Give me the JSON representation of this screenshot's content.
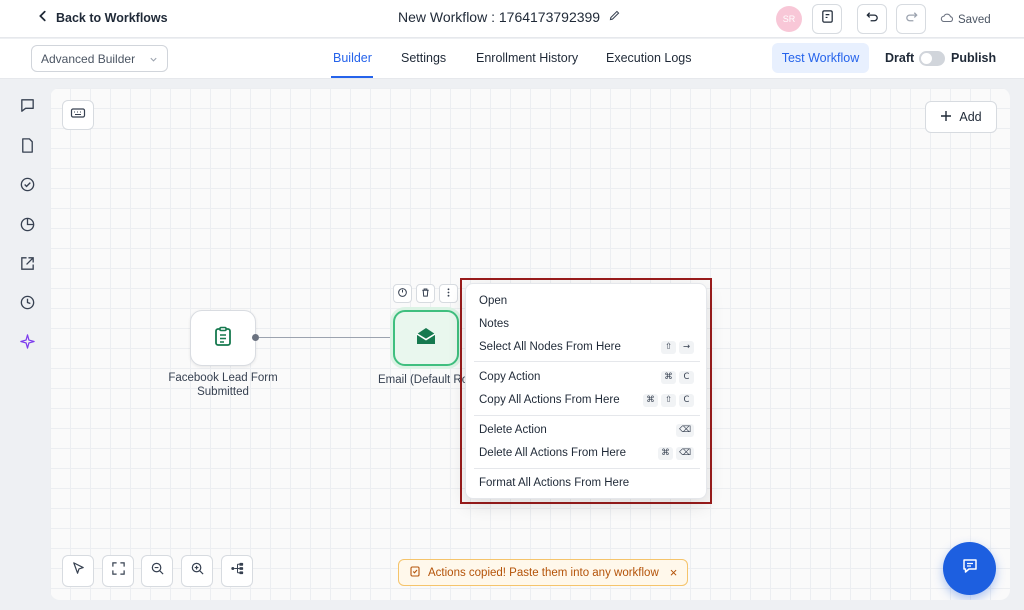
{
  "header": {
    "back_label": "Back to Workflows",
    "workflow_title": "New Workflow : 1764173792399",
    "avatar_initials": "SR",
    "saved_label": "Saved"
  },
  "nav": {
    "mode_select_value": "Advanced Builder",
    "tabs": [
      {
        "label": "Builder",
        "active": true
      },
      {
        "label": "Settings",
        "active": false
      },
      {
        "label": "Enrollment History",
        "active": false
      },
      {
        "label": "Execution Logs",
        "active": false
      }
    ],
    "test_workflow_label": "Test Workflow",
    "draft_label": "Draft",
    "publish_label": "Publish",
    "publish_toggle_on": false
  },
  "canvas": {
    "add_label": "Add",
    "nodes": [
      {
        "label_line1": "Facebook Lead Form",
        "label_line2": "Submitted",
        "icon": "clipboard-list-icon"
      },
      {
        "label": "Email (Default Ro",
        "icon": "envelope-open-icon"
      }
    ]
  },
  "context_menu": {
    "items": [
      {
        "label": "Open",
        "shortcut": []
      },
      {
        "label": "Notes",
        "shortcut": []
      },
      {
        "label": "Select All Nodes From Here",
        "shortcut": [
          "⇧",
          "→"
        ]
      },
      {
        "label": "Copy Action",
        "shortcut": [
          "⌘",
          "C"
        ]
      },
      {
        "label": "Copy All Actions From Here",
        "shortcut": [
          "⌘",
          "⇧",
          "C"
        ]
      },
      {
        "label": "Delete Action",
        "shortcut": [
          "⌫"
        ]
      },
      {
        "label": "Delete All Actions From Here",
        "shortcut": [
          "⌘",
          "⌫"
        ]
      },
      {
        "label": "Format All Actions From Here",
        "shortcut": []
      }
    ]
  },
  "toast": {
    "message": "Actions copied! Paste them into any workflow",
    "close": "×"
  },
  "colors": {
    "accent": "#2563eb",
    "node_green": "#16794f",
    "fab": "#1d5fe0",
    "highlight_frame": "#9a1c1c"
  }
}
